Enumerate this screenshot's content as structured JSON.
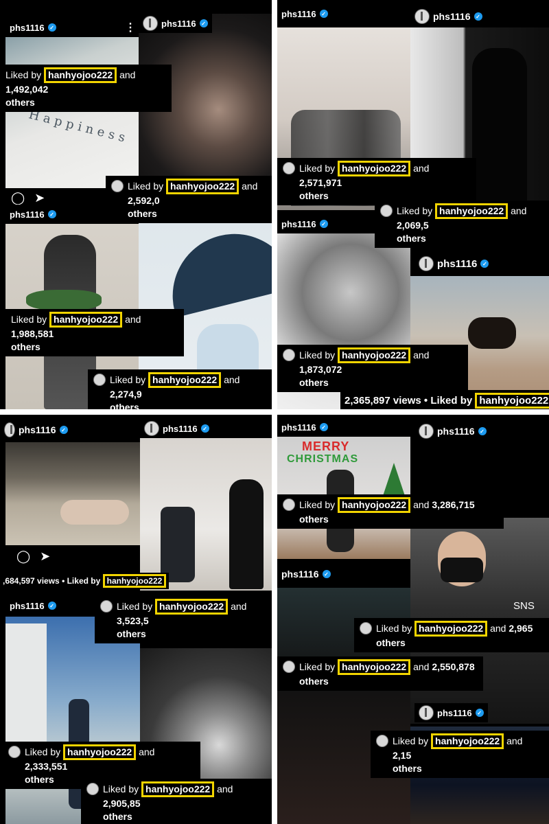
{
  "username": "phs1116",
  "liked_by_prefix": "Liked by",
  "liker": "hanhyojoo222",
  "and_word": "and",
  "others_word": "others",
  "accent_box_color": "#f2d400",
  "verified_color": "#1d9bf0",
  "posts": [
    {
      "count": "1,492,042"
    },
    {
      "count": "2,592,0"
    },
    {
      "count": "1,988,581"
    },
    {
      "count": "2,274,9"
    },
    {
      "count": "2,571,971"
    },
    {
      "count": "2,069,5"
    },
    {
      "count": "1,873,072"
    },
    {
      "count": "3,523,5"
    },
    {
      "count": "2,333,551"
    },
    {
      "count": "2,905,85"
    },
    {
      "count": "3,286,715"
    },
    {
      "count": "2,965"
    },
    {
      "count": "2,550,878"
    },
    {
      "count": "2,15"
    }
  ],
  "views": [
    {
      "text": "2,365,897 views • Liked by"
    },
    {
      "text": ",684,597 views • Liked by"
    }
  ],
  "overlay_texts": {
    "happiness": "Happiness",
    "merry": "MERRY",
    "christmas": "CHRISTMAS",
    "sns": "SNS"
  },
  "icons": [
    "comment-icon",
    "share-icon",
    "more-options-icon",
    "verified-icon",
    "avatar-icon"
  ]
}
